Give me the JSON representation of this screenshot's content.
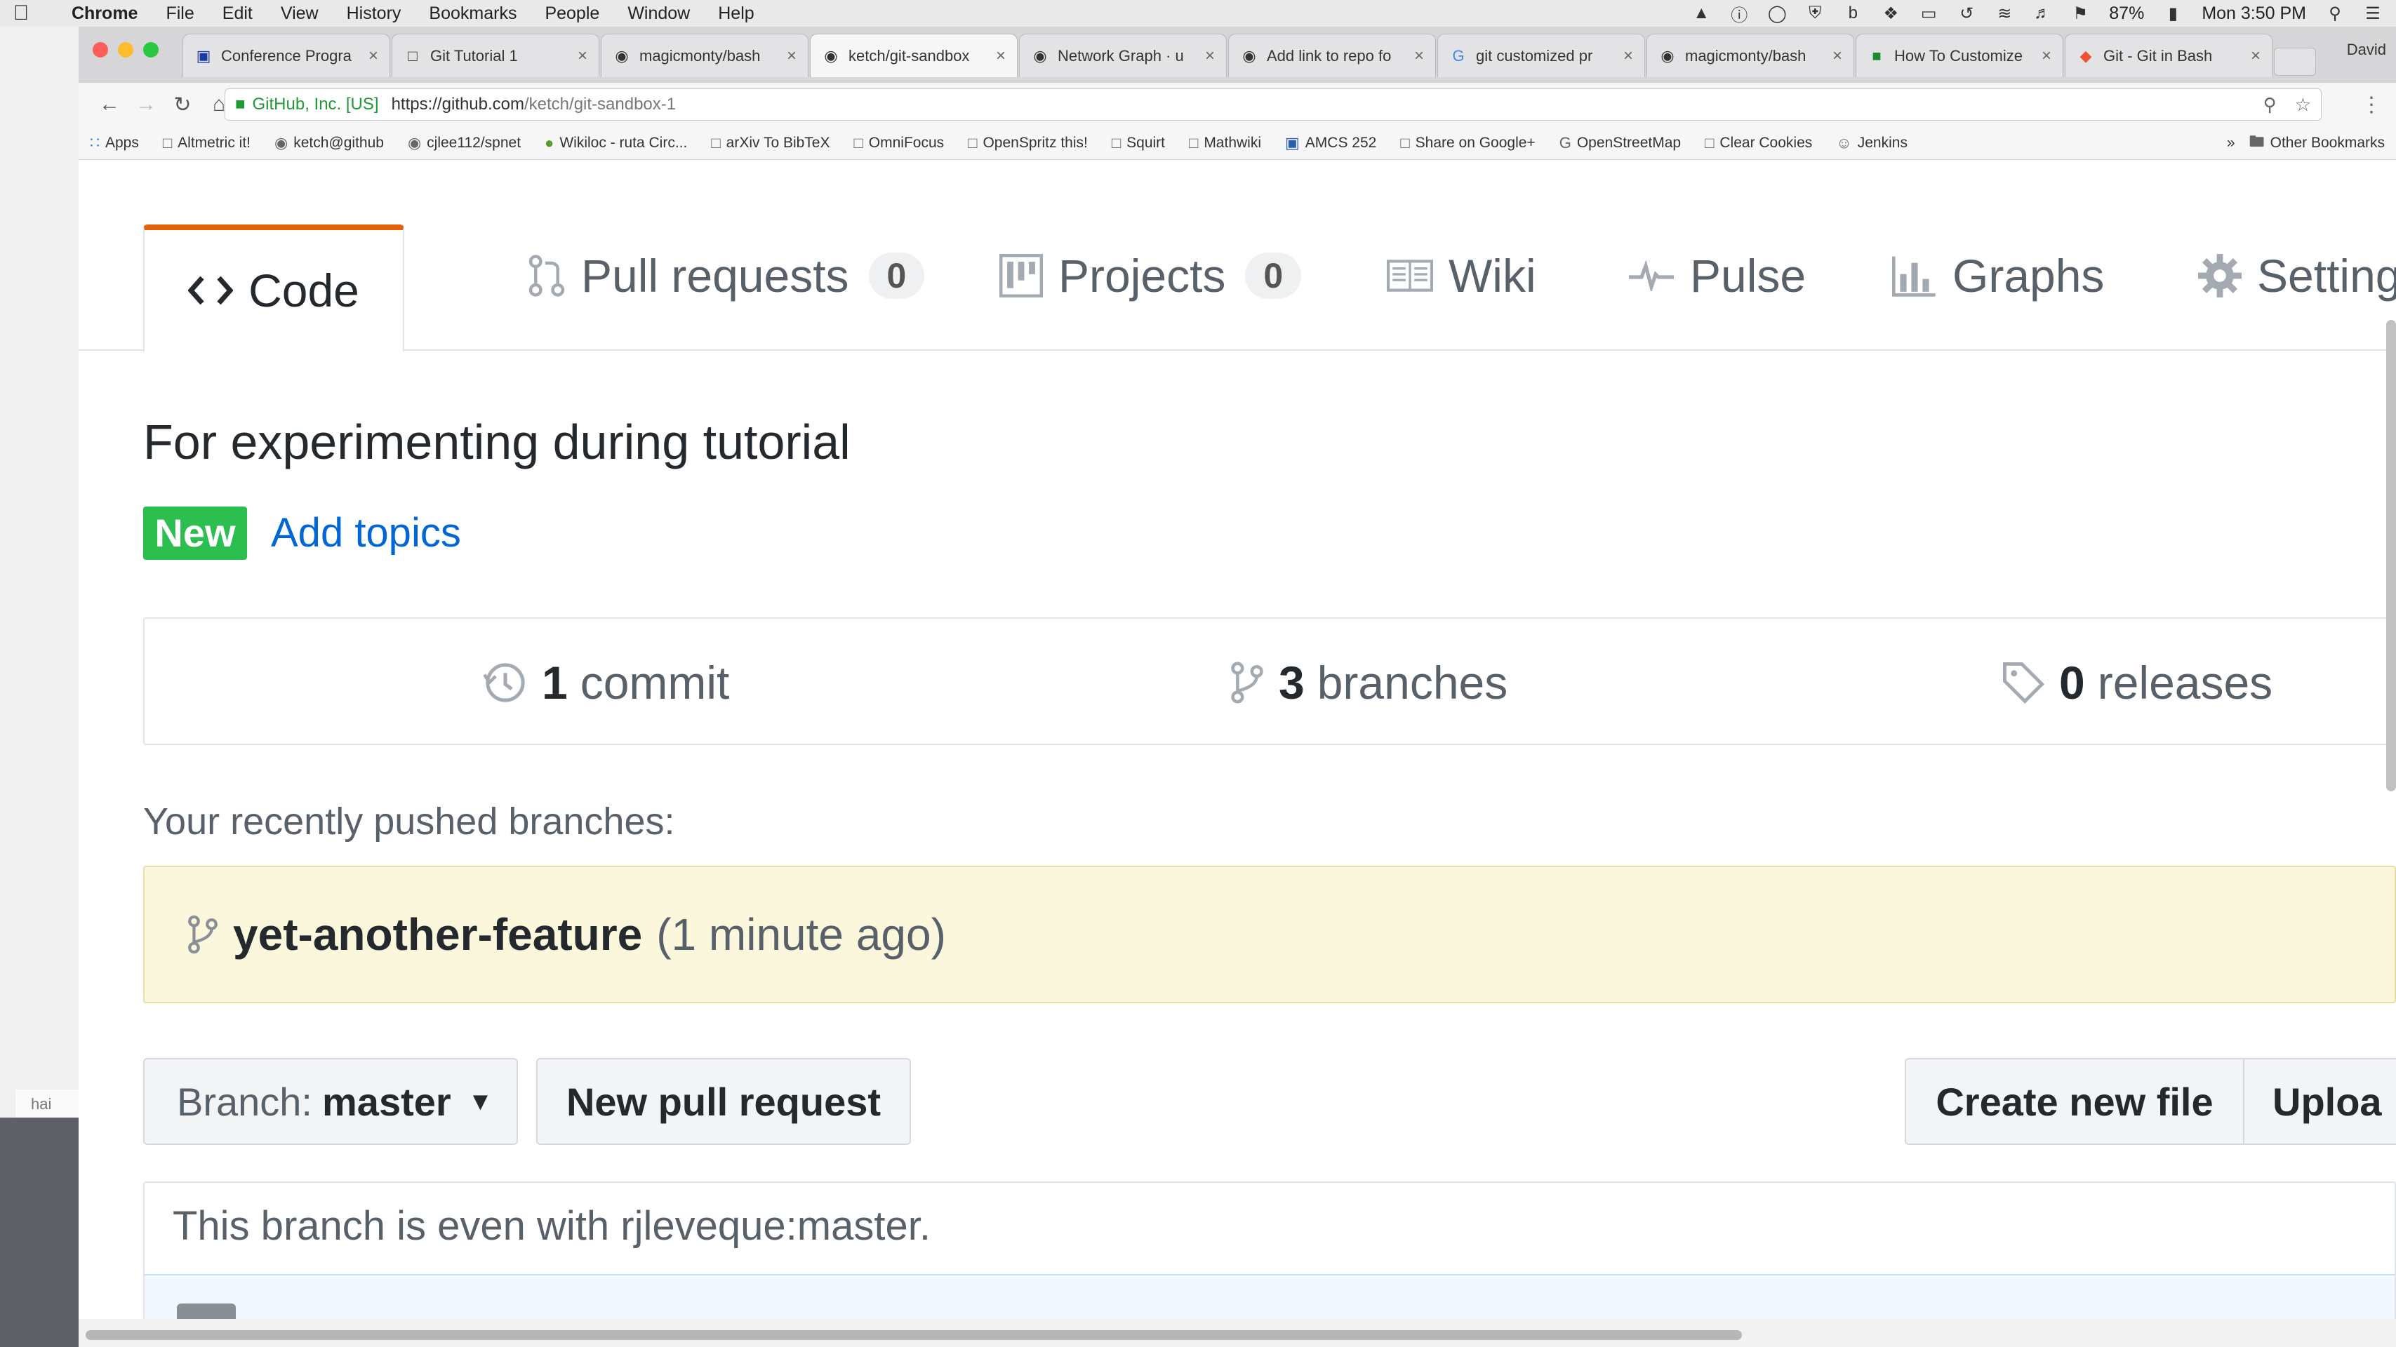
{
  "menubar": {
    "app": "Chrome",
    "items": [
      "File",
      "Edit",
      "View",
      "History",
      "Bookmarks",
      "People",
      "Window",
      "Help"
    ],
    "battery": "87%",
    "clock": "Mon 3:50 PM"
  },
  "browser": {
    "profile": "David",
    "tabs": [
      {
        "title": "Conference Progra",
        "icon": "conference-icon"
      },
      {
        "title": "Git Tutorial 1",
        "icon": "page-icon"
      },
      {
        "title": "magicmonty/bash",
        "icon": "github-icon"
      },
      {
        "title": "ketch/git-sandbox",
        "icon": "github-icon"
      },
      {
        "title": "Network Graph · u",
        "icon": "github-icon"
      },
      {
        "title": "Add link to repo fo",
        "icon": "github-icon"
      },
      {
        "title": "git customized pr",
        "icon": "google-icon"
      },
      {
        "title": "magicmonty/bash",
        "icon": "github-icon"
      },
      {
        "title": "How To Customize",
        "icon": "green-icon"
      },
      {
        "title": "Git - Git in Bash",
        "icon": "git-icon"
      }
    ],
    "address": {
      "secure_label": "GitHub, Inc. [US]",
      "url_host": "https://github.com",
      "url_path": "/ketch/git-sandbox-1"
    },
    "bookmarks": [
      "Apps",
      "Altmetric it!",
      "ketch@github",
      "cjlee112/spnet",
      "Wikiloc - ruta Circ...",
      "arXiv To BibTeX",
      "OmniFocus",
      "OpenSpritz this!",
      "Squirt",
      "Mathwiki",
      "AMCS 252",
      "Share on Google+",
      "OpenStreetMap",
      "Clear Cookies",
      "Jenkins"
    ],
    "other_bookmarks": "Other Bookmarks"
  },
  "desktop": {
    "mini_label": "hai"
  },
  "repo": {
    "tabs": {
      "code": "Code",
      "pull_requests": "Pull requests",
      "pull_requests_count": "0",
      "projects": "Projects",
      "projects_count": "0",
      "wiki": "Wiki",
      "pulse": "Pulse",
      "graphs": "Graphs",
      "settings": "Settings"
    },
    "description": "For experimenting during tutorial",
    "new_badge": "New",
    "add_topics": "Add topics",
    "summary": {
      "commits_count": "1",
      "commits_label": "commit",
      "branches_count": "3",
      "branches_label": "branches",
      "releases_count": "0",
      "releases_label": "releases"
    },
    "recent_label": "Your recently pushed branches:",
    "recent_branch": {
      "name": "yet-another-feature",
      "time": "(1 minute ago)"
    },
    "branch_select": {
      "label": "Branch:",
      "value": "master"
    },
    "new_pull_request": "New pull request",
    "create_new_file": "Create new file",
    "upload": "Uploa",
    "even_text": "This branch is even with rjleveque:master."
  },
  "colors": {
    "accent_orange": "#e36209",
    "badge_green": "#2cbe4e",
    "link_blue": "#0366d6",
    "recent_bg": "#fbf7dc"
  }
}
